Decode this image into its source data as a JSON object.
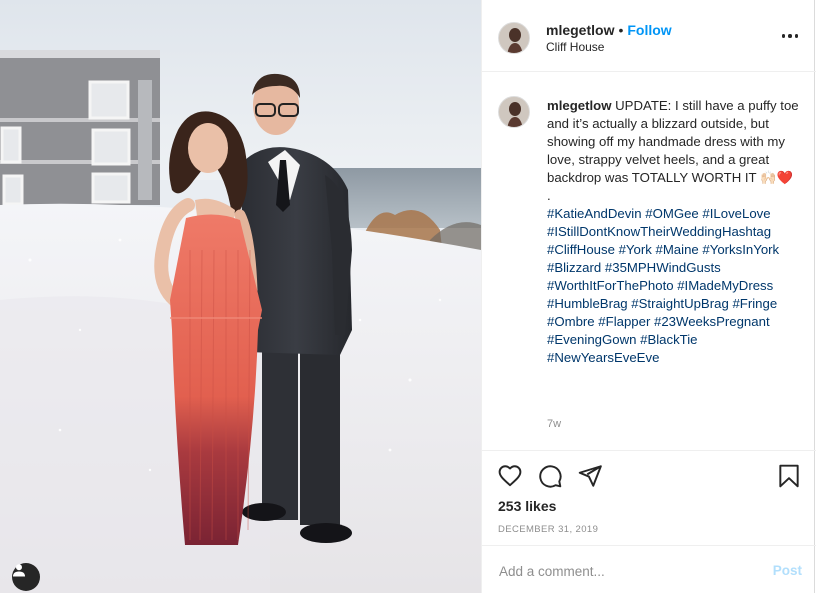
{
  "post": {
    "username": "mlegetlow",
    "follow_label": "Follow",
    "location": "Cliff House",
    "caption_prefix": "UPDATE: I still have a puffy toe and it’s actually a blizzard outside, but showing off my handmade dress with my love, strappy velvet heels, and a great backdrop was TOTALLY WORTH IT",
    "caption_emoji": "🙌🏻❤️",
    "caption_dot": ".",
    "hashtags": "#KatieAndDevin #OMGee #ILoveLove #IStillDontKnowTheirWeddingHashtag #CliffHouse #York #Maine #YorksInYork #Blizzard #35MPHWindGusts #WorthItForThePhoto #IMadeMyDress #HumbleBrag #StraightUpBrag #Fringe #Ombre #Flapper #23WeeksPregnant #EveningGown #BlackTie #NewYearsEveEve",
    "time_ago": "7w",
    "likes": "253 likes",
    "date": "DECEMBER 31, 2019"
  },
  "comment": {
    "placeholder": "Add a comment...",
    "post_label": "Post"
  },
  "icons": {
    "more": "more-options-icon",
    "like": "heart-icon",
    "comment": "comment-icon",
    "share": "share-icon",
    "save": "bookmark-icon",
    "tag": "user-tag-icon"
  },
  "colors": {
    "link": "#0095f6",
    "hashtag": "#00376b",
    "muted": "#8e8e8e",
    "post_disabled": "#b2dffc",
    "dress_top": "#e96e5a",
    "dress_bottom": "#8a2a37"
  }
}
